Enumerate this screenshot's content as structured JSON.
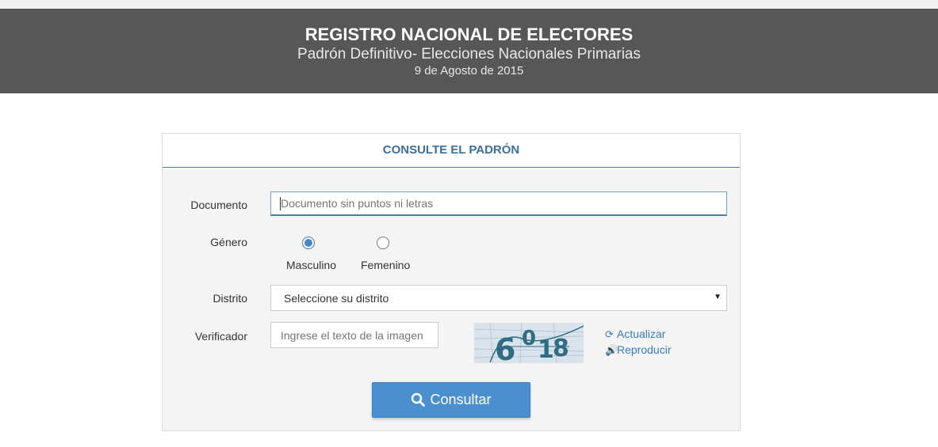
{
  "header": {
    "title": "REGISTRO NACIONAL DE ELECTORES",
    "subtitle": "Padrón Definitivo- Elecciones Nacionales Primarias",
    "date": "9 de Agosto de 2015"
  },
  "panel": {
    "title": "CONSULTE EL PADRÓN"
  },
  "form": {
    "documento": {
      "label": "Documento",
      "placeholder": "Documento sin puntos ni letras",
      "value": ""
    },
    "genero": {
      "label": "Género",
      "options": [
        {
          "label": "Masculino",
          "checked": true
        },
        {
          "label": "Femenino",
          "checked": false
        }
      ]
    },
    "distrito": {
      "label": "Distrito",
      "selected": "Seleccione su distrito"
    },
    "verificador": {
      "label": "Verificador",
      "placeholder": "Ingrese el texto de la imagen",
      "captcha_text": "6018",
      "refresh_label": "Actualizar",
      "play_label": "Reproducir"
    },
    "submit_label": "Consultar"
  },
  "colors": {
    "header_bg": "#575757",
    "accent": "#4a8fd0",
    "link": "#3b7ab8",
    "panel_title": "#3b6f99"
  },
  "icons": {
    "submit": "search-icon",
    "refresh": "refresh-icon",
    "play": "speaker-icon",
    "select": "caret-down-icon"
  }
}
